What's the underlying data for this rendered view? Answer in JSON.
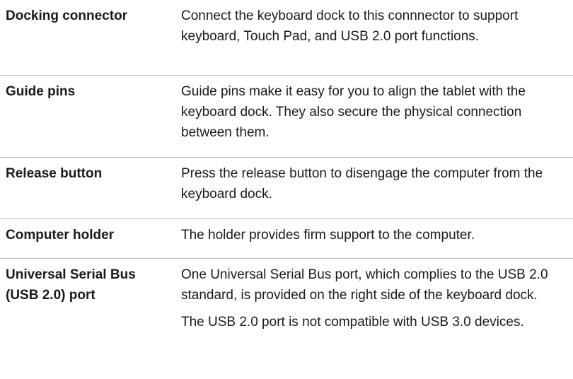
{
  "rows": [
    {
      "term": "Docking connector",
      "description": [
        "Connect the keyboard dock to this connnector to support keyboard, Touch Pad, and USB 2.0 port functions."
      ]
    },
    {
      "term": "Guide pins",
      "description": [
        "Guide pins make it easy for you to align the tablet with the keyboard dock. They also secure the physical connection between them."
      ]
    },
    {
      "term": "Release button",
      "description": [
        "Press the release button to disengage the computer from the keyboard dock."
      ]
    },
    {
      "term": "Computer holder",
      "description": [
        "The holder provides firm support to the computer."
      ]
    },
    {
      "term": "Universal Serial Bus (USB 2.0) port",
      "description": [
        "One Universal Serial Bus port, which complies to the USB 2.0 standard, is provided on the right side of the keyboard dock.",
        "The USB 2.0 port is not compatible with USB 3.0 devices."
      ]
    }
  ]
}
